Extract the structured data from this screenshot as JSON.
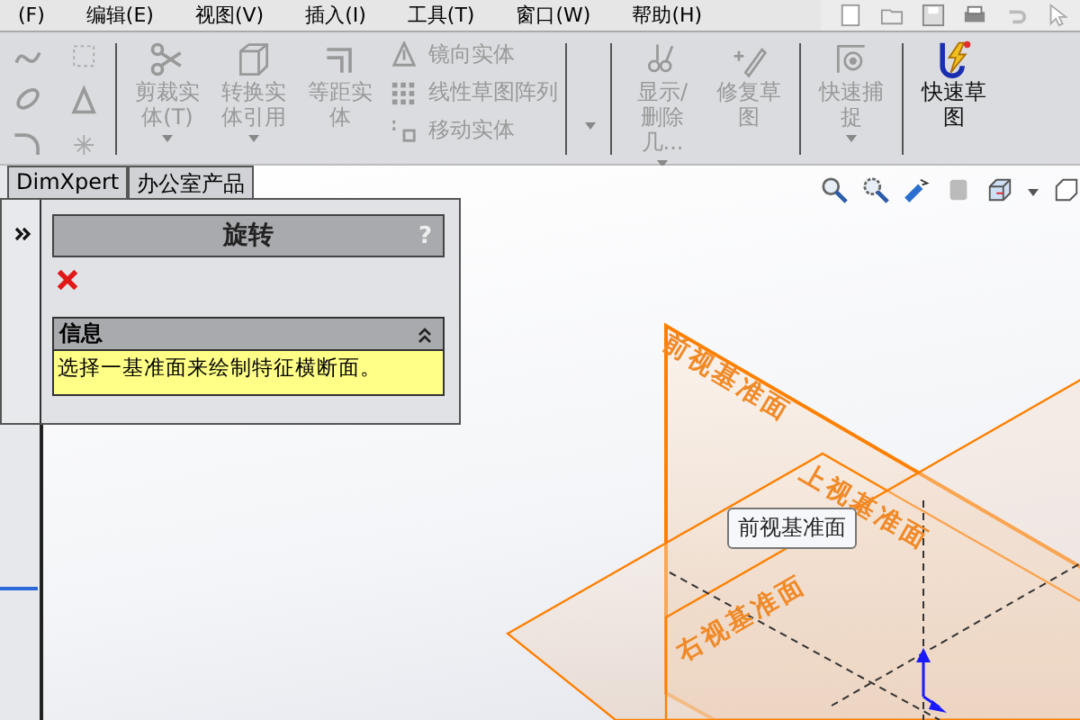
{
  "menu_bar": [
    "(F)",
    "编辑(E)",
    "视图(V)",
    "插入(I)",
    "工具(T)",
    "窗口(W)",
    "帮助(H)"
  ],
  "toolbar": {
    "tools": [
      {
        "label": "剪裁实体(T)",
        "disabled": true,
        "dropdown": true
      },
      {
        "label": "转换实体引用",
        "disabled": true,
        "dropdown": true
      },
      {
        "label": "等距实体",
        "disabled": true,
        "dropdown": false
      }
    ],
    "list": [
      {
        "label": "镜向实体",
        "disabled": true
      },
      {
        "label": "线性草图阵列",
        "disabled": true
      },
      {
        "label": "移动实体",
        "disabled": true
      }
    ],
    "tools2": [
      {
        "label": "显示/删除几...",
        "disabled": true,
        "dropdown": true
      },
      {
        "label": "修复草图",
        "disabled": true,
        "dropdown": false
      },
      {
        "label": "快速捕捉",
        "disabled": true,
        "dropdown": true
      },
      {
        "label": "快速草图",
        "disabled": false,
        "dropdown": false
      }
    ]
  },
  "panel_tabs": [
    {
      "label": "DimXpert"
    },
    {
      "label": "办公室产品"
    }
  ],
  "property_manager": {
    "title": "旋转",
    "help": "?",
    "section": {
      "title": "信息",
      "text": "选择一基准面来绘制特征横断面。"
    }
  },
  "viewport": {
    "planes": [
      {
        "label": "前视基准面"
      },
      {
        "label": "上视基准面"
      },
      {
        "label": "右视基准面"
      }
    ],
    "tooltip": "前视基准面"
  }
}
